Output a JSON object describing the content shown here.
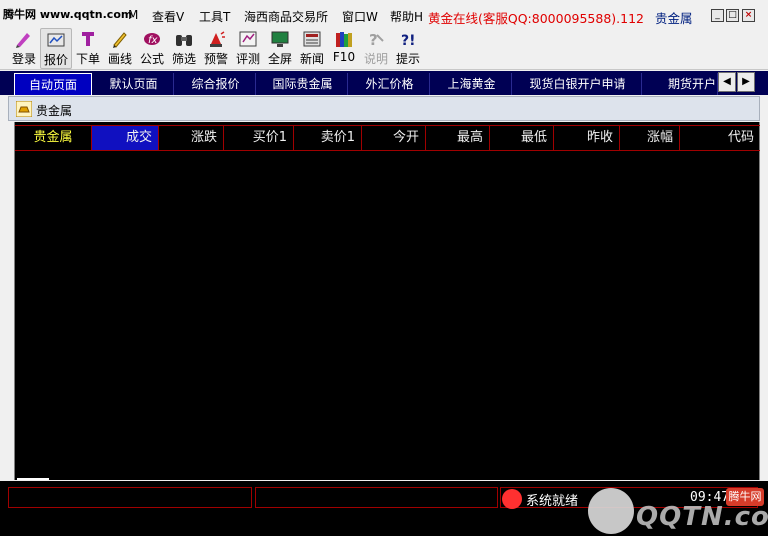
{
  "site_logo": "腾牛网 www.qqtn.com",
  "menu": {
    "items": [
      "M",
      "查看V",
      "工具T",
      "海西商品交易所",
      "窗口W",
      "帮助H"
    ],
    "marquee": "黄金在线(客服QQ:8000095588).112",
    "marquee_category": "贵金属"
  },
  "toolbar": {
    "items": [
      {
        "label": "登录",
        "icon": "pen-icon"
      },
      {
        "label": "报价",
        "icon": "quote-icon"
      },
      {
        "label": "下单",
        "icon": "order-icon"
      },
      {
        "label": "画线",
        "icon": "draw-line-icon"
      },
      {
        "label": "公式",
        "icon": "formula-icon"
      },
      {
        "label": "筛选",
        "icon": "binoculars-icon"
      },
      {
        "label": "预警",
        "icon": "alarm-icon"
      },
      {
        "label": "评测",
        "icon": "review-icon"
      },
      {
        "label": "全屏",
        "icon": "monitor-icon"
      },
      {
        "label": "新闻",
        "icon": "news-icon"
      },
      {
        "label": "F10",
        "icon": "books-icon"
      },
      {
        "label": "说明",
        "icon": "help-disabled-icon"
      },
      {
        "label": "提示",
        "icon": "hint-icon"
      }
    ]
  },
  "tabs": [
    "自动页面",
    "默认页面",
    "综合报价",
    "国际贵金属",
    "外汇价格",
    "上海黄金",
    "现货白银开户申请",
    "期货开户"
  ],
  "active_tab": 0,
  "panel": {
    "title": "贵金属"
  },
  "grid": {
    "columns": [
      "贵金属",
      "成交",
      "涨跌",
      "买价1",
      "卖价1",
      "今开",
      "最高",
      "最低",
      "昨收",
      "涨幅",
      "代码"
    ],
    "rows": []
  },
  "status": {
    "text": "系统就绪",
    "clock": "09:47:17"
  },
  "watermark": {
    "brand": "QQTN.com",
    "badge": "腾牛网"
  },
  "colors": {
    "tab_bar_bg": "#000054",
    "active_tab_bg": "#0000c0",
    "grid_bg": "#000000",
    "grid_lines": "#a00000",
    "header_name_color": "#ffff40",
    "marquee_color": "#e00000",
    "status_dot": "#ff3030"
  }
}
